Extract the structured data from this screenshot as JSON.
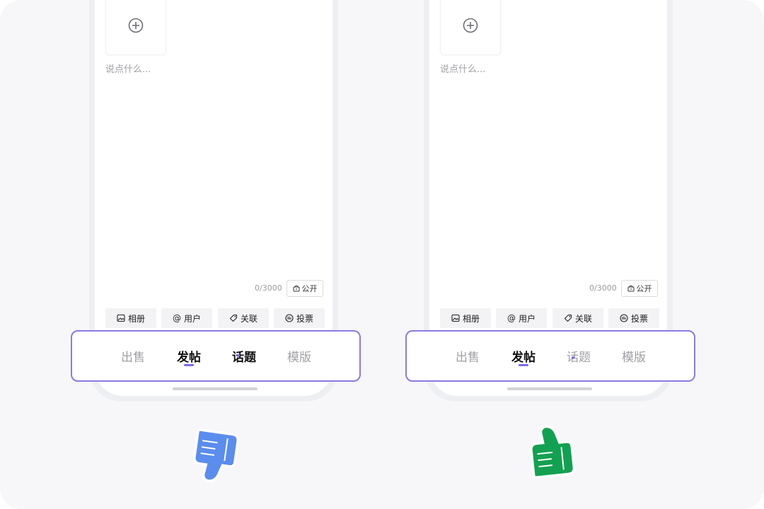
{
  "colors": {
    "accent": "#7b68ee",
    "frame_border": "#8c7ae2",
    "thumbs_down": "#5b8def",
    "thumbs_up": "#12a150"
  },
  "panels": [
    {
      "id": "bad",
      "verdict_icon": "thumbs-down-icon",
      "editor": {
        "placeholder": "说点什么...",
        "counter": "0/3000",
        "privacy_label": "公开"
      },
      "toolbar": [
        {
          "label": "相册",
          "icon": "image-icon"
        },
        {
          "label": "用户",
          "icon": "at-icon"
        },
        {
          "label": "关联",
          "icon": "tag-icon"
        },
        {
          "label": "投票",
          "icon": "poll-icon"
        }
      ],
      "tabs": [
        {
          "label": "出售",
          "active": false
        },
        {
          "label": "发帖",
          "active": true
        },
        {
          "label": "话题",
          "active": true
        },
        {
          "label": "模版",
          "active": false
        }
      ]
    },
    {
      "id": "good",
      "verdict_icon": "thumbs-up-icon",
      "editor": {
        "placeholder": "说点什么...",
        "counter": "0/3000",
        "privacy_label": "公开"
      },
      "toolbar": [
        {
          "label": "相册",
          "icon": "image-icon"
        },
        {
          "label": "用户",
          "icon": "at-icon"
        },
        {
          "label": "关联",
          "icon": "tag-icon"
        },
        {
          "label": "投票",
          "icon": "poll-icon"
        }
      ],
      "tabs": [
        {
          "label": "出售",
          "active": false
        },
        {
          "label": "发帖",
          "active": true
        },
        {
          "label": "话题",
          "active": false
        },
        {
          "label": "模版",
          "active": false
        }
      ]
    }
  ]
}
